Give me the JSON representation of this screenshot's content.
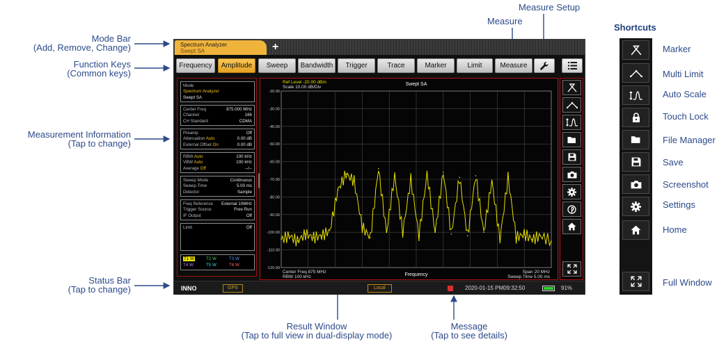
{
  "callouts": {
    "mode_bar": [
      "Mode Bar",
      "(Add, Remove, Change)"
    ],
    "function_keys": [
      "Function Keys",
      "(Common keys)"
    ],
    "measurement_info": [
      "Measurement Information",
      "(Tap to change)"
    ],
    "status_bar": [
      "Status Bar",
      "(Tap to change)"
    ],
    "result_window": [
      "Result Window",
      "(Tap to full view in dual-display mode)"
    ],
    "message": [
      "Message",
      "(Tap to see details)"
    ],
    "measure": "Measure",
    "measure_setup": "Measure Setup"
  },
  "mode_tab": {
    "line1": "Spectrum Analyzer",
    "line2": "Swept SA",
    "add": "+"
  },
  "function_keys": [
    "Frequency",
    "Amplitude",
    "Sweep",
    "Bandwidth",
    "Trigger",
    "Trace",
    "Marker",
    "Limit",
    "Measure"
  ],
  "selected_key": "Amplitude",
  "info": {
    "mode": {
      "label": "Mode",
      "app": "Spectrum Analyzer",
      "sub": "Swept SA"
    },
    "freq": [
      {
        "k": "Center Freq",
        "v": "875.000 MHz"
      },
      {
        "k": "Channel",
        "v": "166"
      },
      {
        "k": "CH Standard",
        "v": "CDMA"
      }
    ],
    "amp": [
      {
        "k": "Preamp",
        "m": "",
        "v": "Off"
      },
      {
        "k": "Attenuation",
        "m": "Auto",
        "v": "0.00 dB"
      },
      {
        "k": "External Offset",
        "m": "On",
        "v": "0.00 dB"
      }
    ],
    "bw": [
      {
        "k": "RBW",
        "m": "Auto",
        "v": "100 kHz"
      },
      {
        "k": "VBW",
        "m": "Auto",
        "v": "100 kHz"
      },
      {
        "k": "Average",
        "m": "Off",
        "v": "--/--"
      }
    ],
    "sweep": [
      {
        "k": "Sweep Mode",
        "v": "Continuous"
      },
      {
        "k": "Sweep Time",
        "v": "5.00 ms"
      },
      {
        "k": "Detector",
        "v": "Sample"
      }
    ],
    "ref": [
      {
        "k": "Freq Reference",
        "v": "External 10MHz"
      },
      {
        "k": "Trigger Source",
        "v": "Free Run"
      },
      {
        "k": "IF Output",
        "v": "Off"
      }
    ],
    "limit": {
      "k": "Limit",
      "v": "Off"
    },
    "traces": [
      "T1 W",
      "T2 W",
      "T3 W",
      "T4 W",
      "T5 W",
      "T6 W"
    ]
  },
  "plot": {
    "ref_level": "Ref Level -20.00 dBm",
    "scale": "Scale 10.00 dB/Div",
    "title": "Swept SA",
    "center": "Center Freq 875 MHz",
    "rbw": "RBW 100 kHz",
    "xlabel": "Frequency",
    "span": "Span 20 MHz",
    "sweep_time": "Sweep Time 5.00 ms"
  },
  "chart_data": {
    "type": "line",
    "title": "Swept SA",
    "xlabel": "Frequency",
    "ylabel": "",
    "y_ticks": [
      -20,
      -30,
      -40,
      -50,
      -60,
      -70,
      -80,
      -90,
      -100,
      -110,
      -120
    ],
    "ylim": [
      -120,
      -20
    ],
    "xlim": [
      865,
      885
    ],
    "grid": true,
    "series": [
      {
        "color": "#e8e000",
        "x": [
          865.0,
          865.6,
          866.2,
          866.8,
          867.4,
          868.0,
          868.6,
          869.2,
          869.8,
          870.4,
          871.0,
          871.6,
          872.2,
          872.8,
          873.4,
          874.0,
          874.6,
          875.2,
          875.8,
          876.4,
          877.0,
          877.6,
          878.2,
          878.8,
          879.4,
          880.0,
          880.6,
          881.2,
          881.8,
          882.4,
          883.0,
          883.6,
          884.2,
          885.0
        ],
        "y": [
          -104,
          -102,
          -105,
          -101,
          -103,
          -102,
          -99,
          -76,
          -67,
          -71,
          -97,
          -103,
          -64,
          -100,
          -68,
          -100,
          -70,
          -102,
          -67,
          -100,
          -66,
          -101,
          -69,
          -102,
          -68,
          -100,
          -71,
          -104,
          -69,
          -103,
          -101,
          -104,
          -102,
          -105
        ]
      }
    ]
  },
  "status": {
    "logo": "INNO",
    "gps": "GPS",
    "local": "Local",
    "datetime": "2020-01-15   PM09:32:50",
    "battery": "91%"
  },
  "shortcuts": {
    "title": "Shortcuts",
    "items": [
      "Marker",
      "Multi Limit",
      "Auto Scale",
      "Touch Lock",
      "File Manager",
      "Save",
      "Screenshot",
      "Settings",
      "Home",
      "Full Window"
    ],
    "icons": [
      "marker-icon",
      "multi-limit-icon",
      "auto-scale-icon",
      "lock-icon",
      "folder-icon",
      "save-icon",
      "camera-icon",
      "gear-icon",
      "home-icon",
      "full-window-icon"
    ]
  },
  "colors": {
    "accent": "#f0b43c",
    "trace": "#e8e000",
    "frame": "#b01414",
    "callout": "#2d4a8a"
  }
}
